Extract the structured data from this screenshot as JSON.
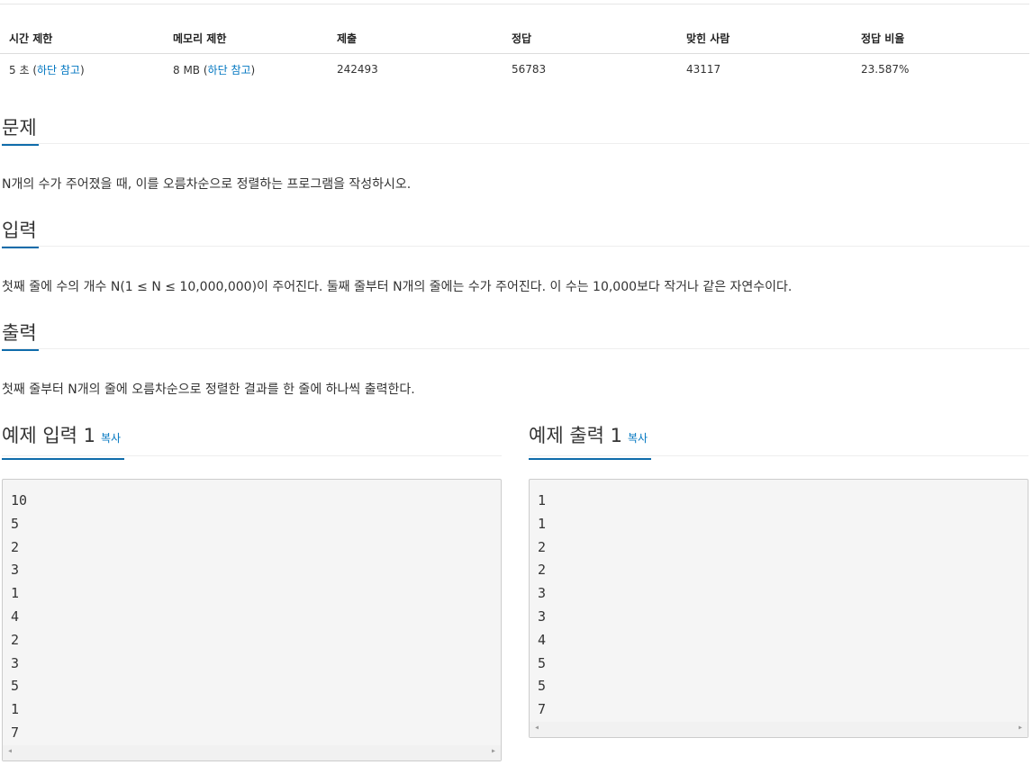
{
  "stats": {
    "headers": [
      "시간 제한",
      "메모리 제한",
      "제출",
      "정답",
      "맞힌 사람",
      "정답 비율"
    ],
    "time_limit": "5 초 ",
    "time_note_open": "(",
    "time_note": "하단 참고",
    "time_note_close": ")",
    "memory_limit": "8 MB ",
    "memory_note_open": "(",
    "memory_note": "하단 참고",
    "memory_note_close": ")",
    "submissions": "242493",
    "accepted": "56783",
    "solvers": "43117",
    "ratio": "23.587%"
  },
  "problem": {
    "title": "문제",
    "text": "N개의 수가 주어졌을 때, 이를 오름차순으로 정렬하는 프로그램을 작성하시오."
  },
  "input": {
    "title": "입력",
    "text": "첫째 줄에 수의 개수 N(1 ≤ N ≤ 10,000,000)이 주어진다. 둘째 줄부터 N개의 줄에는 수가 주어진다. 이 수는 10,000보다 작거나 같은 자연수이다."
  },
  "output": {
    "title": "출력",
    "text": "첫째 줄부터 N개의 줄에 오름차순으로 정렬한 결과를 한 줄에 하나씩 출력한다."
  },
  "sample_input": {
    "title": "예제 입력 1",
    "copy_label": "복사",
    "lines": [
      "10",
      "5",
      "2",
      "3",
      "1",
      "4",
      "2",
      "3",
      "5",
      "1",
      "7"
    ]
  },
  "sample_output": {
    "title": "예제 출력 1",
    "copy_label": "복사",
    "lines": [
      "1",
      "1",
      "2",
      "2",
      "3",
      "3",
      "4",
      "5",
      "5",
      "7"
    ]
  },
  "scroll": {
    "left_arrow": "◂",
    "right_arrow": "▸"
  },
  "colors": {
    "link": "#0076c0",
    "accent_underline": "#0f6cab",
    "code_bg": "#f5f5f5"
  }
}
